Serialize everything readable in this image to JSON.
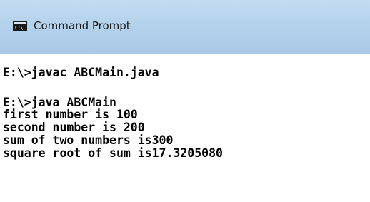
{
  "window": {
    "title": "Command Prompt",
    "icon": "command-prompt-icon"
  },
  "console": {
    "lines": [
      "E:\\>javac ABCMain.java",
      "E:\\>java ABCMain",
      "first number is 100",
      "second number is 200",
      "sum of two numbers is300",
      "square root of sum is17.3205080"
    ]
  }
}
